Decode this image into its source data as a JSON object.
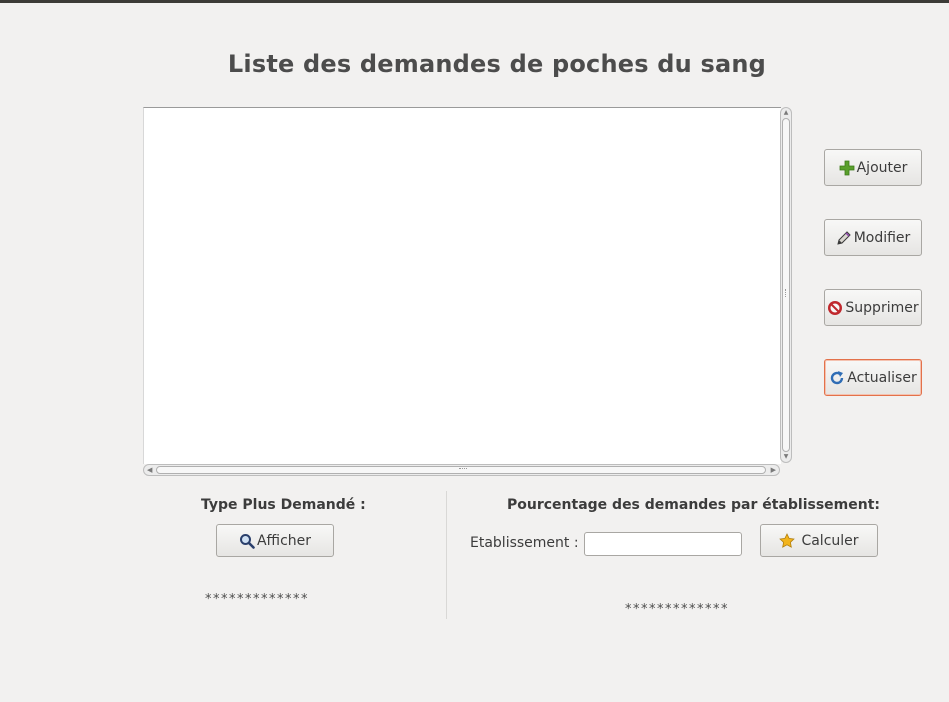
{
  "title": "Liste des demandes de poches du sang",
  "actions": {
    "add_label": "Ajouter",
    "edit_label": "Modifier",
    "delete_label": "Supprimer",
    "refresh_label": "Actualiser"
  },
  "most_requested": {
    "heading": "Type Plus Demandé :",
    "button_label": "Afficher",
    "result": "*************"
  },
  "percentage": {
    "heading": "Pourcentage des demandes par établissement:",
    "field_label": "Etablissement :",
    "field_value": "",
    "button_label": "Calculer",
    "result": "*************"
  },
  "icons": {
    "add": "plus-icon",
    "edit": "pencil-icon",
    "delete": "no-entry-icon",
    "refresh": "refresh-icon",
    "show": "magnifier-icon",
    "calculate": "star-icon"
  },
  "colors": {
    "focus_border": "#e3714a",
    "add_icon": "#5aa02c",
    "delete_icon": "#c0282d",
    "refresh_icon": "#2f6db5",
    "star_icon": "#f2b41c"
  }
}
